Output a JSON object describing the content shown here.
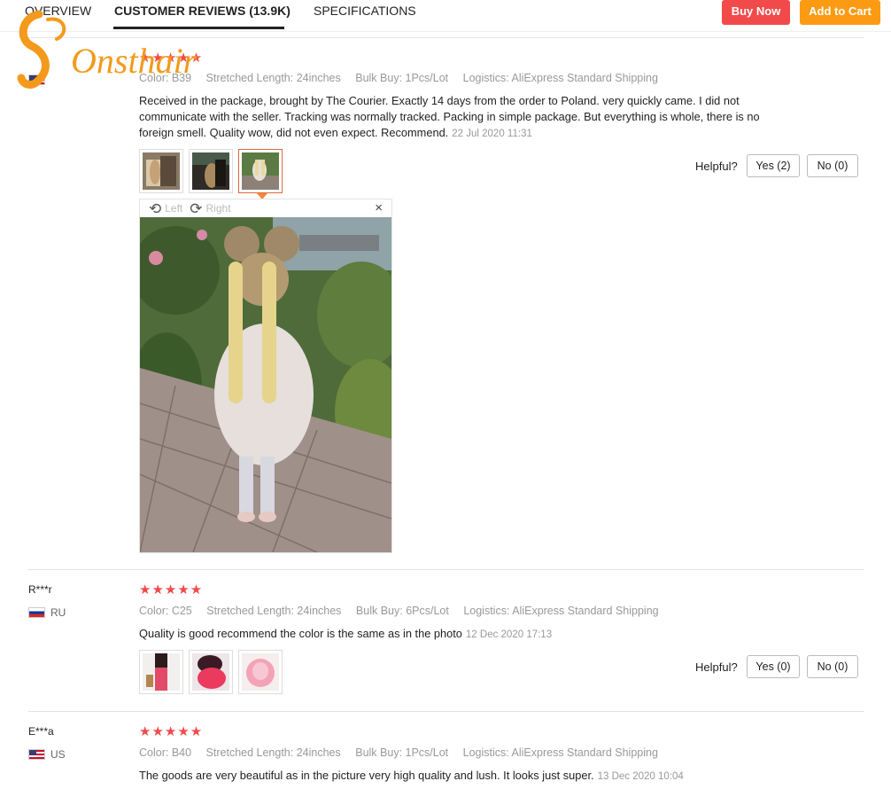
{
  "nav": {
    "tabs": [
      "OVERVIEW",
      "CUSTOMER REVIEWS (13.9K)",
      "SPECIFICATIONS"
    ],
    "buy_now": "Buy Now",
    "add_to_cart": "Add to Cart"
  },
  "logo": {
    "text": "Onsthair"
  },
  "reviews": [
    {
      "reviewer": "",
      "country": "",
      "stars": "★★★★★",
      "meta": [
        "Color: B39",
        "Stretched Length: 24inches",
        "Bulk Buy: 1Pcs/Lot",
        "Logistics: AliExpress Standard Shipping"
      ],
      "text": "Received in the package, brought by The Courier. Exactly 14 days from the order to Poland. very quickly came. I did not communicate with the seller. Tracking was normally tracked. Packing in simple package. But everything is whole, there is no foreign smell. Quality wow, did not even expect. Recommend.",
      "date": "22 Jul 2020 11:31",
      "helpful_label": "Helpful?",
      "yes": "Yes (2)",
      "no": "No (0)",
      "viewer": {
        "left": "Left",
        "right": "Right",
        "close": "×"
      }
    },
    {
      "reviewer": "R***r",
      "country": "RU",
      "stars": "★★★★★",
      "meta": [
        "Color: C25",
        "Stretched Length: 24inches",
        "Bulk Buy: 6Pcs/Lot",
        "Logistics: AliExpress Standard Shipping"
      ],
      "text": "Quality is good recommend the color is the same as in the photo",
      "date": "12 Dec 2020 17:13",
      "helpful_label": "Helpful?",
      "yes": "Yes (0)",
      "no": "No (0)"
    },
    {
      "reviewer": "E***a",
      "country": "US",
      "stars": "★★★★★",
      "meta": [
        "Color: B40",
        "Stretched Length: 24inches",
        "Bulk Buy: 1Pcs/Lot",
        "Logistics: AliExpress Standard Shipping"
      ],
      "text": "The goods are very beautiful as in the picture very high quality and lush. It looks just super.",
      "date": "13 Dec 2020 10:04"
    }
  ],
  "colors": {
    "star": "#f04a4a",
    "buy": "#f24a4a",
    "cart": "#fb9b14",
    "logo": "#f39a1c"
  }
}
